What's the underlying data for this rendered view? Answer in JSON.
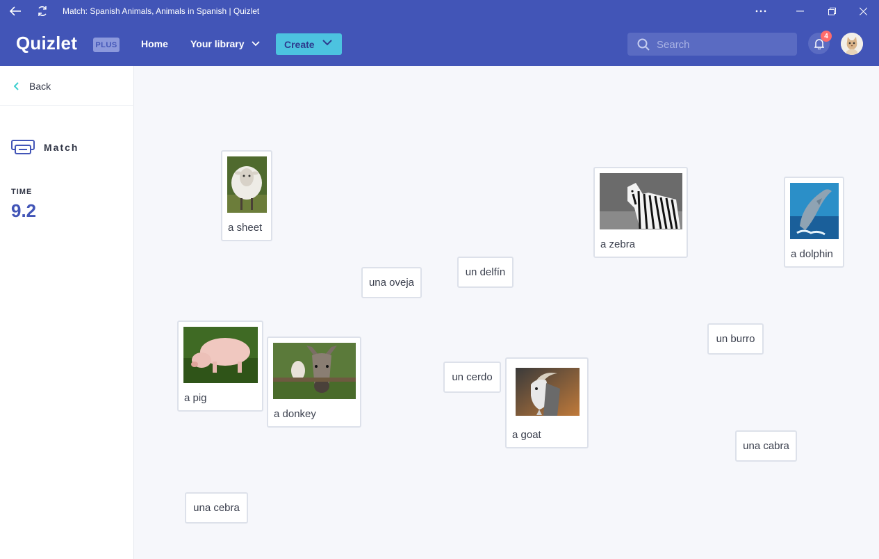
{
  "window": {
    "title": "Match: Spanish Animals, Animals in Spanish | Quizlet"
  },
  "nav": {
    "logo": "Quizlet",
    "plan_badge": "PLUS",
    "home": "Home",
    "library": "Your library",
    "create": "Create",
    "search_placeholder": "Search",
    "notification_count": "4"
  },
  "sidebar": {
    "back": "Back",
    "mode": "Match",
    "time_label": "TIME",
    "time_value": "9.2"
  },
  "board": {
    "image_cards": [
      {
        "label": "a sheet",
        "picture": "sheep"
      },
      {
        "label": "a zebra",
        "picture": "zebra"
      },
      {
        "label": "a dolphin",
        "picture": "dolphin"
      },
      {
        "label": "a pig",
        "picture": "pig"
      },
      {
        "label": "a donkey",
        "picture": "donkey"
      },
      {
        "label": "a goat",
        "picture": "goat"
      }
    ],
    "word_cards": [
      "una oveja",
      "un delfín",
      "un burro",
      "un cerdo",
      "una cabra",
      "una cebra"
    ]
  },
  "colors": {
    "brand": "#4255b7",
    "accent": "#4cc3e0",
    "badge": "#ff6b6b"
  }
}
